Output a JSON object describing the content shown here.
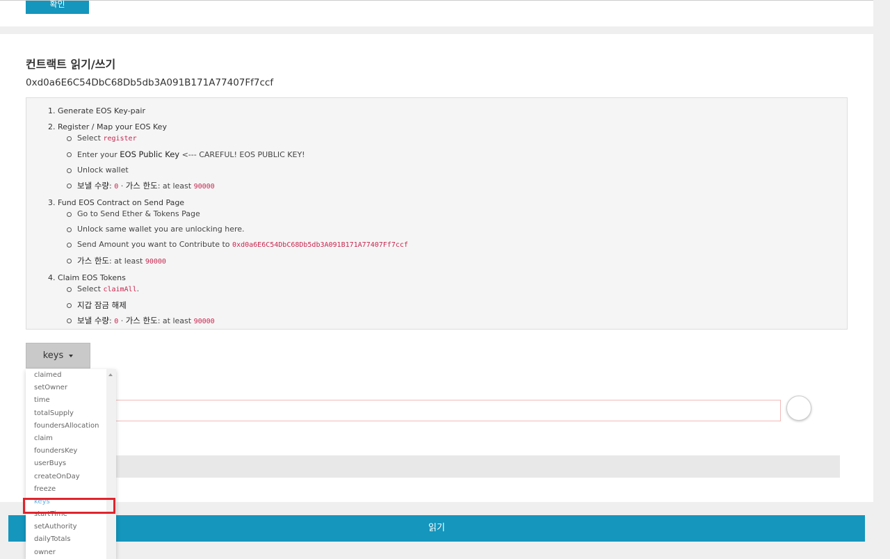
{
  "top_button_label": "확인",
  "section": {
    "title": "컨트랙트 읽기/쓰기",
    "address": "0xd0a6E6C54DbC68Db5db3A091B171A77407Ff7ccf"
  },
  "instructions": {
    "step1": "1. Generate EOS Key-pair",
    "step2": "2. Register / Map your EOS Key",
    "step2_b1_prefix": "Select ",
    "step2_b1_code": "register",
    "step2_b2_prefix": "Enter your ",
    "step2_b2_emph": "EOS Public Key",
    "step2_b2_suffix": " <--- CAREFUL! EOS PUBLIC KEY!",
    "step2_b3": "Unlock wallet",
    "step2_b4_label1": "보낼 수량",
    "step2_b4_sep1": ": ",
    "step2_b4_code1": "0",
    "step2_b4_sep2": " · ",
    "step2_b4_label2": "가스 한도",
    "step2_b4_sep3": ": at least ",
    "step2_b4_code2": "90000",
    "step3": "3. Fund EOS Contract on Send Page",
    "step3_b1": "Go to Send Ether & Tokens Page",
    "step3_b2": "Unlock same wallet you are unlocking here.",
    "step3_b3_prefix": "Send Amount you want to Contribute to ",
    "step3_b3_code": "0xd0a6E6C54DbC68Db5db3A091B171A77407Ff7ccf",
    "step3_b4_label": "가스 한도",
    "step3_b4_sep": ": at least ",
    "step3_b4_code": "90000",
    "step4": "4. Claim EOS Tokens",
    "step4_b1_prefix": "Select ",
    "step4_b1_code": "claimAll",
    "step4_b1_suffix": ".",
    "step4_b2": "지갑 잠금 해제",
    "step4_b3_label1": "보낼 수량",
    "step4_b3_sep1": ": ",
    "step4_b3_code1": "0",
    "step4_b3_sep2": " · ",
    "step4_b3_label2": "가스 한도",
    "step4_b3_sep3": ": at least ",
    "step4_b3_code2": "90000"
  },
  "function_select": {
    "selected": "keys",
    "options": [
      "claimed",
      "setOwner",
      "time",
      "totalSupply",
      "foundersAllocation",
      "claim",
      "foundersKey",
      "userBuys",
      "createOnDay",
      "freeze",
      "keys",
      "startTime",
      "setAuthority",
      "dailyTotals",
      "owner"
    ]
  },
  "read_button_label": "읽기",
  "colors": {
    "accent": "#1496bd",
    "highlight": "#e0242c",
    "code": "#c7254e"
  }
}
